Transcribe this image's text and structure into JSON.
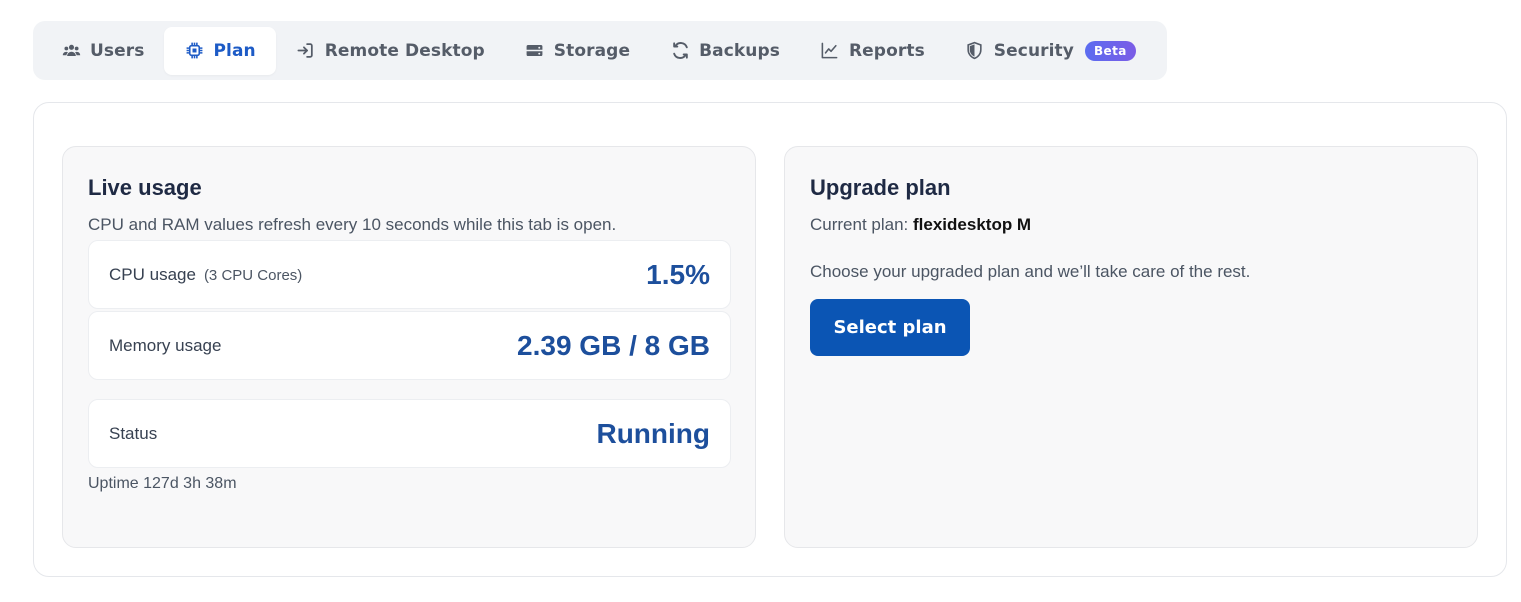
{
  "tabs": [
    {
      "label": "Users",
      "icon": "users-icon"
    },
    {
      "label": "Plan",
      "icon": "chip-icon",
      "active": true
    },
    {
      "label": "Remote Desktop",
      "icon": "sign-in-icon"
    },
    {
      "label": "Storage",
      "icon": "hard-drive-icon"
    },
    {
      "label": "Backups",
      "icon": "refresh-icon"
    },
    {
      "label": "Reports",
      "icon": "chart-line-icon"
    },
    {
      "label": "Security",
      "icon": "shield-icon",
      "badge": "Beta"
    }
  ],
  "live_usage": {
    "title": "Live usage",
    "description": "CPU and RAM values refresh every 10 seconds while this tab is open.",
    "cpu": {
      "label": "CPU usage",
      "sub": "(3 CPU Cores)",
      "value": "1.5%"
    },
    "memory": {
      "label": "Memory usage",
      "value": "2.39 GB / 8 GB"
    },
    "status": {
      "label": "Status",
      "value": "Running"
    },
    "uptime": "Uptime 127d 3h 38m"
  },
  "upgrade": {
    "title": "Upgrade plan",
    "current_prefix": "Current plan:",
    "current_plan": "flexidesktop M",
    "description": "Choose your upgraded plan and we’ll take care of the rest.",
    "button_label": "Select plan"
  },
  "colors": {
    "accent": "#1d5bc6",
    "value": "#1d4f9c",
    "button": "#0b55b4"
  }
}
